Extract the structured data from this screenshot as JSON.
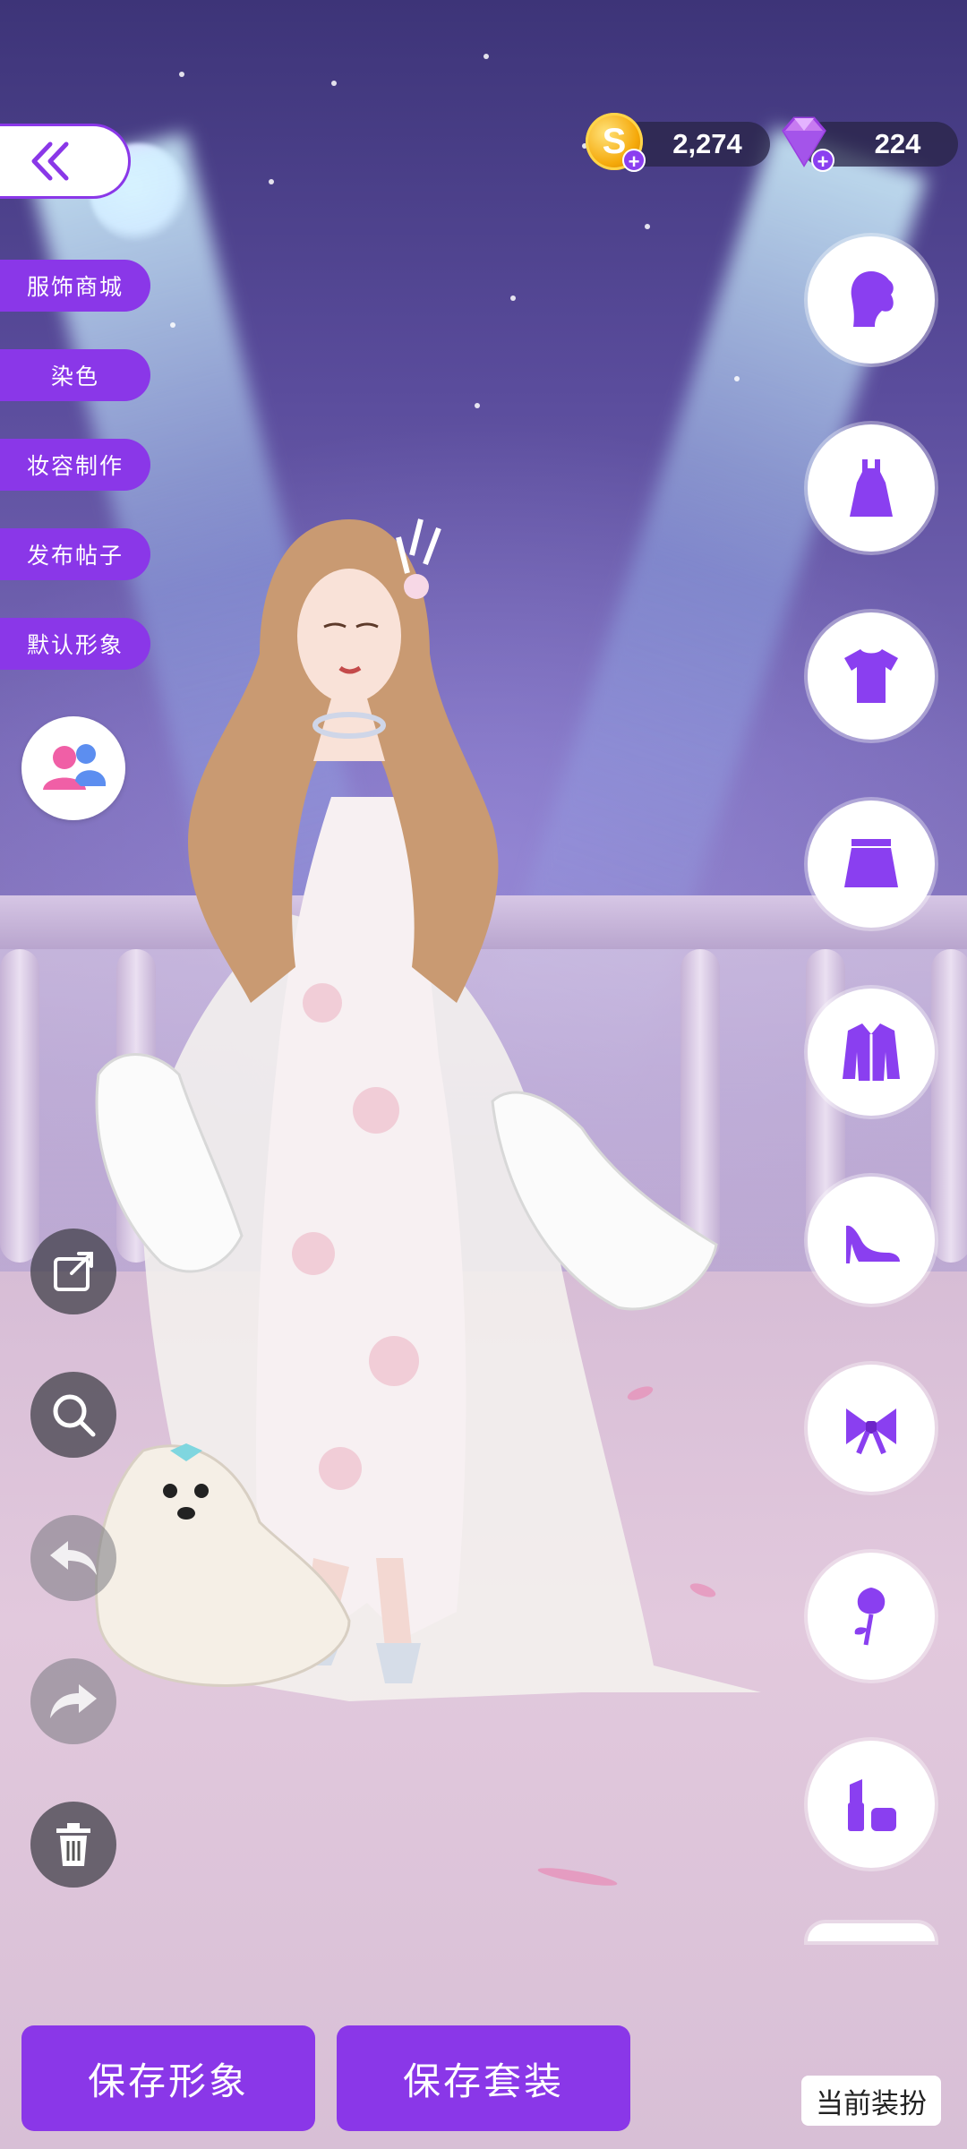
{
  "currency": {
    "coins": "2,274",
    "gems": "224",
    "coin_symbol": "S",
    "add_symbol": "+"
  },
  "left_menu": [
    "服饰商城",
    "染色",
    "妆容制作",
    "发布帖子",
    "默认形象"
  ],
  "right_categories": [
    "hair-icon",
    "dress-icon",
    "top-icon",
    "skirt-icon",
    "coat-icon",
    "shoes-icon",
    "bow-accessory-icon",
    "rose-icon",
    "makeup-icon"
  ],
  "tools": [
    "share-icon",
    "zoom-icon",
    "undo-icon",
    "redo-icon",
    "trash-icon"
  ],
  "bottom": {
    "save_look": "保存形象",
    "save_outfit": "保存套装",
    "current_outfit": "当前装扮"
  },
  "colors": {
    "accent": "#8a37e8",
    "icon": "#8a3ff0"
  }
}
